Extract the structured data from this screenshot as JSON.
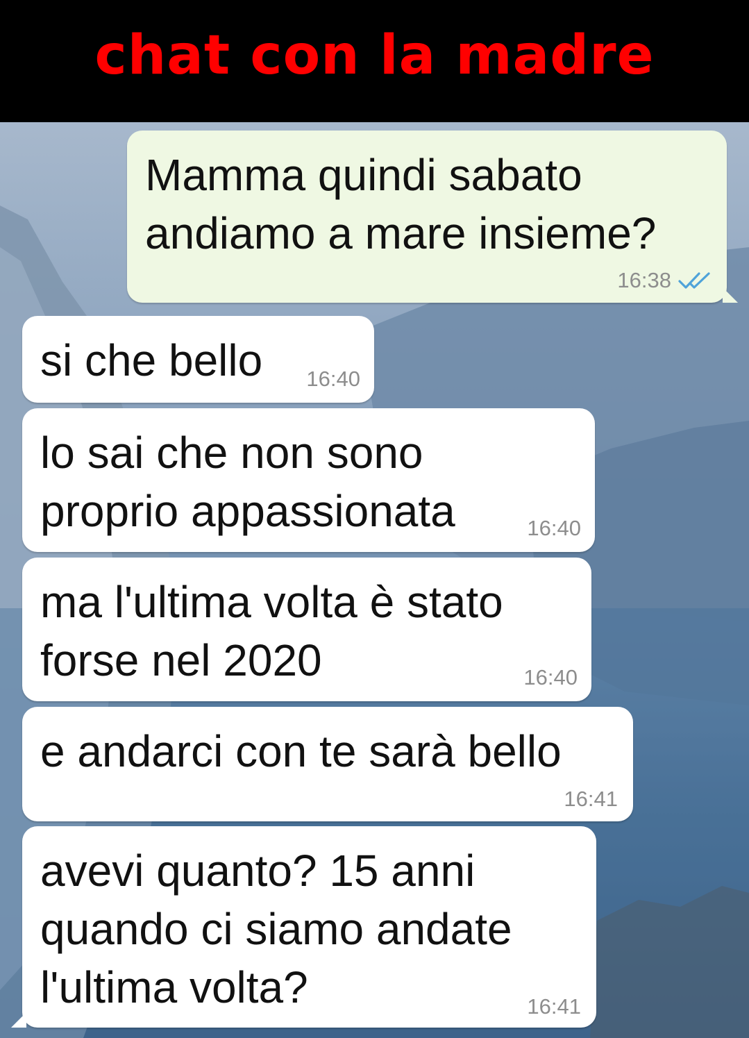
{
  "header": {
    "title": "chat con la madre"
  },
  "colors": {
    "header_bg": "#000000",
    "title": "#ff0000",
    "outgoing_bubble": "#eff8e3",
    "incoming_bubble": "#ffffff",
    "read_ticks": "#4fa3d9",
    "timestamp": "#8d8d8d"
  },
  "messages": [
    {
      "direction": "outgoing",
      "text": "Mamma quindi sabato\nandiamo a mare insieme?",
      "time": "16:38",
      "status_icon": "double-check-icon"
    },
    {
      "direction": "incoming",
      "text": "si che bello",
      "time": "16:40"
    },
    {
      "direction": "incoming",
      "text": "lo sai che non sono\nproprio appassionata",
      "time": "16:40"
    },
    {
      "direction": "incoming",
      "text": "ma l'ultima volta è stato\nforse nel 2020",
      "time": "16:40"
    },
    {
      "direction": "incoming",
      "text": "e andarci con te sarà bello",
      "time": "16:41"
    },
    {
      "direction": "incoming",
      "text": "avevi quanto? 15 anni\nquando ci siamo andate\nl'ultima volta?",
      "time": "16:41"
    }
  ]
}
